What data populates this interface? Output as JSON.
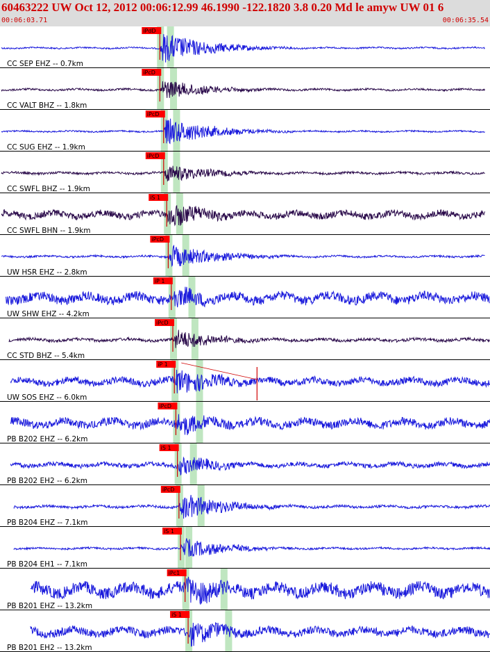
{
  "header": {
    "title": "60463222 UW Oct 12, 2012 00:06:12.99   46.1990 -122.1820  3.8 0.20 Md le amyw UW 01   6",
    "start_time": "00:06:03.71",
    "end_time": "00:06:35.54"
  },
  "colors": {
    "header_bg": "#dcdcdc",
    "header_text": "#d00000",
    "trace_vertical": "#1a1adc",
    "trace_horizontal": "#2a0a4a",
    "pick_box": "#ff0000",
    "pick_line": "#d00000",
    "phase_window": "#bfe6c0",
    "separator": "#000000"
  },
  "chart_data": {
    "type": "line",
    "title": "60463222 UW Oct 12, 2012 00:06:12.99   46.1990 -122.1820  3.8 0.20 Md le amyw UW 01   6",
    "xlim": [
      "00:06:03.71",
      "00:06:35.54"
    ],
    "series": [
      {
        "name": "CC SEP EHZ -- 0.7km",
        "pick": "iPdD",
        "component": "Z",
        "p_time": 10.35,
        "s_time": 11.0,
        "amp": 0.9,
        "noise": 0.04,
        "start": 0.0,
        "end": 31.6
      },
      {
        "name": "CC VALT BHZ -- 1.8km",
        "pick": "iPcD",
        "component": "H",
        "p_time": 10.35,
        "s_time": 11.2,
        "amp": 0.6,
        "noise": 0.05,
        "start": 0.0,
        "end": 31.6
      },
      {
        "name": "CC SUG EHZ -- 1.9km",
        "pick": "iPcD",
        "component": "Z",
        "p_time": 10.6,
        "s_time": 11.4,
        "amp": 0.8,
        "noise": 0.04,
        "start": 0.0,
        "end": 31.6
      },
      {
        "name": "CC SWFL BHZ -- 1.9km",
        "pick": "iPcD",
        "component": "H",
        "p_time": 10.6,
        "s_time": 11.4,
        "amp": 0.55,
        "noise": 0.06,
        "start": 0.0,
        "end": 31.6
      },
      {
        "name": "CC SWFL BHN -- 1.9km",
        "pick": "iS 1",
        "component": "H",
        "p_time": 10.8,
        "s_time": 11.6,
        "amp": 0.75,
        "noise": 0.18,
        "start": 0.0,
        "end": 31.6
      },
      {
        "name": "UW HSR EHZ -- 2.8km",
        "pick": "iPcD",
        "component": "Z",
        "p_time": 10.9,
        "s_time": 12.0,
        "amp": 0.7,
        "noise": 0.05,
        "start": 0.0,
        "end": 31.6
      },
      {
        "name": "UW SHW EHZ -- 4.2km",
        "pick": "iP 1",
        "component": "Z",
        "p_time": 11.1,
        "s_time": 12.4,
        "amp": 0.7,
        "noise": 0.25,
        "start": 0.3,
        "end": 31.9
      },
      {
        "name": "CC STD BHZ -- 5.4km",
        "pick": "iPcD",
        "component": "H",
        "p_time": 11.2,
        "s_time": 12.6,
        "amp": 0.6,
        "noise": 0.08,
        "start": 0.5,
        "end": 31.9
      },
      {
        "name": "UW SOS EHZ -- 6.0km",
        "pick": "iP 1",
        "component": "Z",
        "p_time": 11.3,
        "s_time": 12.9,
        "amp": 0.8,
        "noise": 0.18,
        "start": 0.6,
        "end": 32.1
      },
      {
        "name": "PB B202 EHZ -- 6.2km",
        "pick": "iPcD",
        "component": "Z",
        "p_time": 11.4,
        "s_time": 12.9,
        "amp": 0.7,
        "noise": 0.22,
        "start": 0.6,
        "end": 32.1
      },
      {
        "name": "PB B202 EH2 -- 6.2km",
        "pick": "iS 1",
        "component": "Z",
        "p_time": 11.5,
        "s_time": 12.5,
        "amp": 0.55,
        "noise": 0.12,
        "start": 0.6,
        "end": 32.1
      },
      {
        "name": "PB B204 EHZ -- 7.1km",
        "pick": "iPcD",
        "component": "Z",
        "p_time": 11.6,
        "s_time": 13.0,
        "amp": 0.8,
        "noise": 0.07,
        "start": 0.8,
        "end": 32.3
      },
      {
        "name": "PB B204 EH1 -- 7.1km",
        "pick": "iS 1",
        "component": "Z",
        "p_time": 11.7,
        "s_time": 12.2,
        "amp": 0.6,
        "noise": 0.05,
        "start": 0.8,
        "end": 32.3
      },
      {
        "name": "PB B201 EHZ -- 13.2km",
        "pick": "iPc1",
        "component": "Z",
        "p_time": 12.0,
        "s_time": 14.5,
        "amp": 0.9,
        "noise": 0.32,
        "start": 1.9,
        "end": 33.3
      },
      {
        "name": "PB B201 EH2 -- 13.2km",
        "pick": "iS 1",
        "component": "Z",
        "p_time": 12.2,
        "s_time": 14.8,
        "amp": 0.75,
        "noise": 0.22,
        "start": 1.9,
        "end": 33.3
      }
    ]
  }
}
